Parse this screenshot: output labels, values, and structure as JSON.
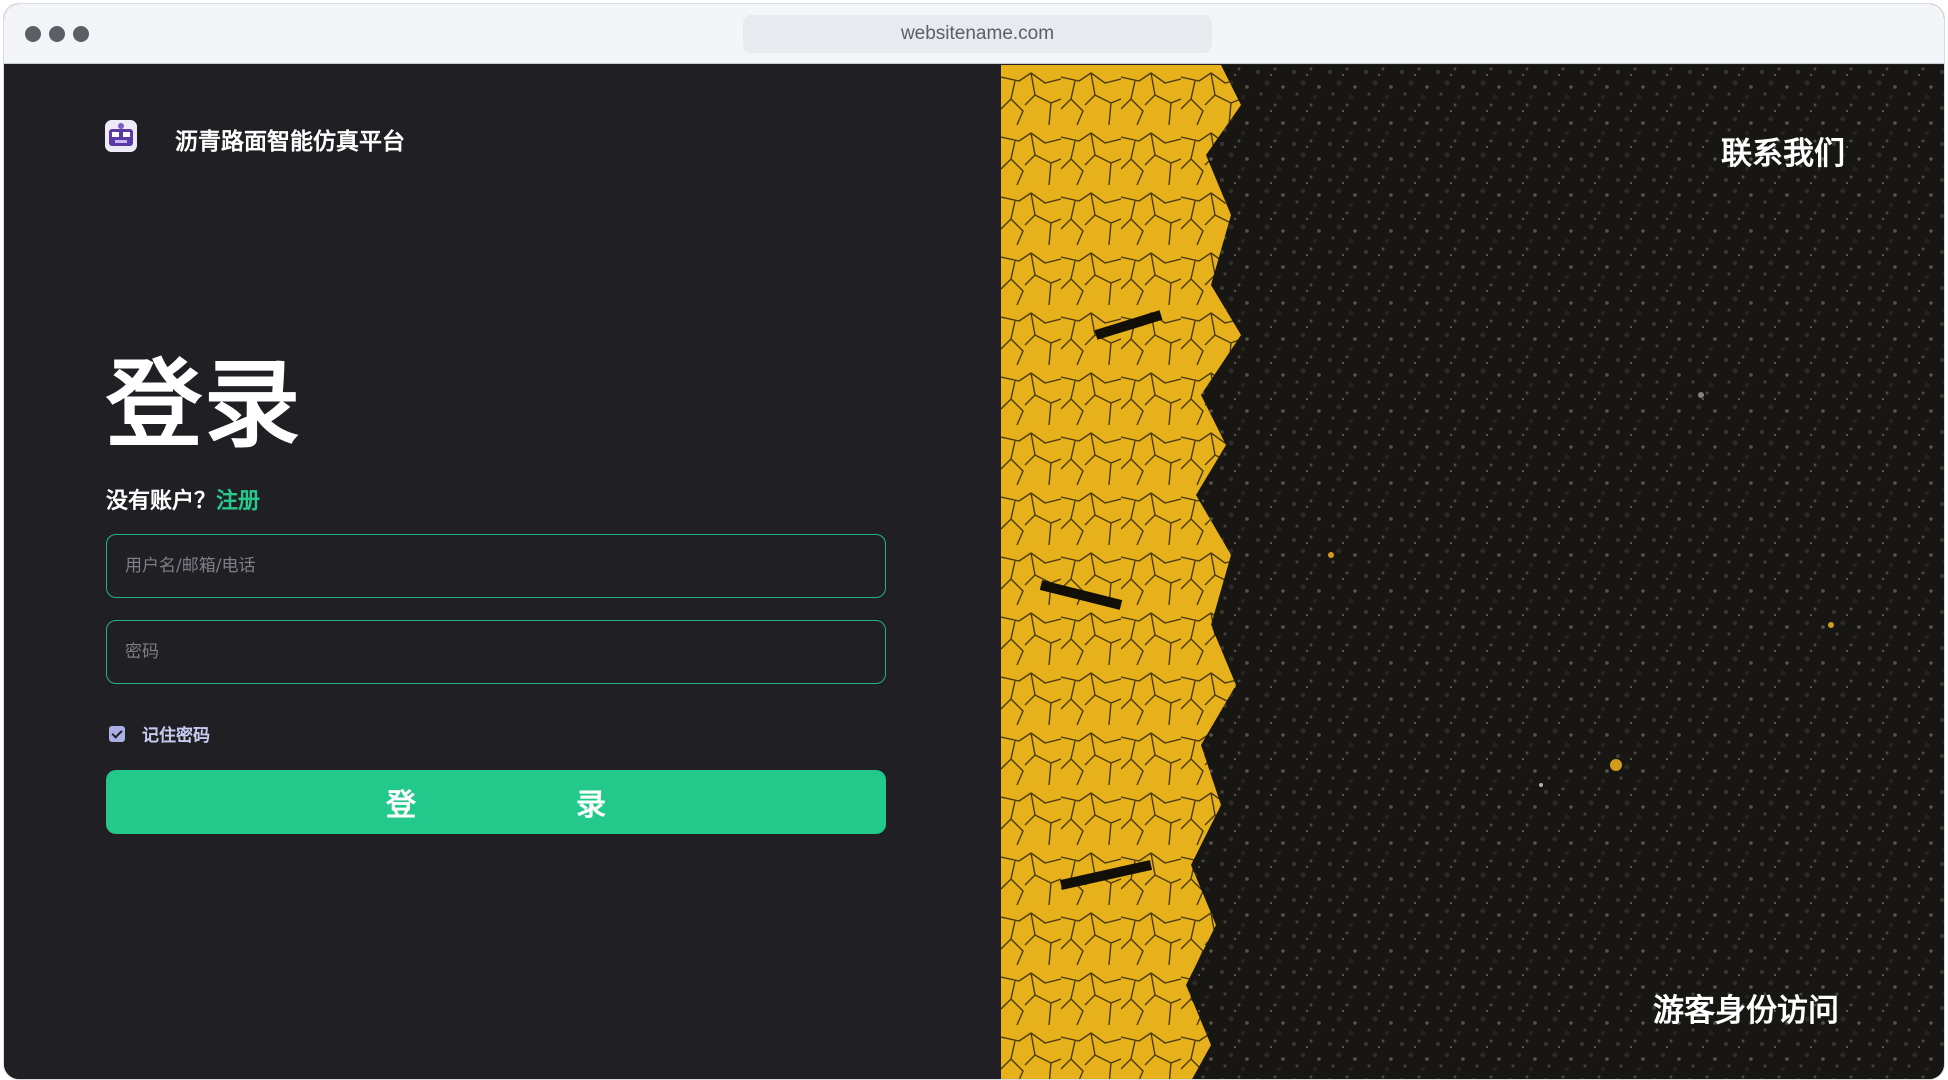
{
  "browser": {
    "url": "websitename.com"
  },
  "brand": {
    "name": "沥青路面智能仿真平台",
    "icon": "platform-logo-icon"
  },
  "login": {
    "title": "登录",
    "no_account_text": "没有账户？",
    "register_link": "注册",
    "username_placeholder": "用户名/邮箱/电话",
    "password_placeholder": "密码",
    "remember_label": "记住密码",
    "remember_checked": true,
    "submit_label": "登录"
  },
  "side": {
    "contact_link": "联系我们",
    "guest_link": "游客身份访问"
  },
  "colors": {
    "accent": "#23c98a",
    "panel_bg": "#202024",
    "asphalt": "#151411",
    "paint_yellow": "#e8b41a"
  }
}
